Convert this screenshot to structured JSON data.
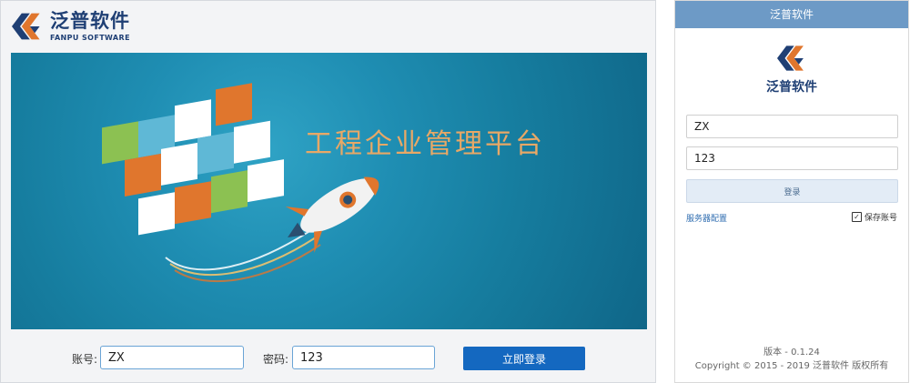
{
  "desktop": {
    "logo": {
      "cn": "泛普软件",
      "en": "FANPU SOFTWARE",
      "icon": "fanpu-logo-icon"
    },
    "banner": {
      "title": "工程企业管理平台",
      "illustration": "cube-and-rocket-illustration"
    },
    "login": {
      "account_label": "账号:",
      "account_value": "ZX",
      "password_label": "密码:",
      "password_value": "123",
      "submit_label": "立即登录"
    },
    "colors": {
      "brand": "#1f3f74",
      "banner_bg": "#167d9f",
      "banner_title": "#e8a866",
      "button": "#1468c0"
    }
  },
  "mobile": {
    "header_title": "泛普软件",
    "logo_text": "泛普软件",
    "account_value": "ZX",
    "password_value": "123",
    "login_label": "登录",
    "server_config_label": "服务器配置",
    "remember_label": "保存账号",
    "remember_checked": true,
    "version": "版本 - 0.1.24",
    "copyright": "Copyright © 2015 - 2019 泛普软件 版权所有",
    "colors": {
      "header": "#6d9ac6",
      "link": "#2f6db0",
      "button_bg": "#e3ecf6"
    }
  }
}
